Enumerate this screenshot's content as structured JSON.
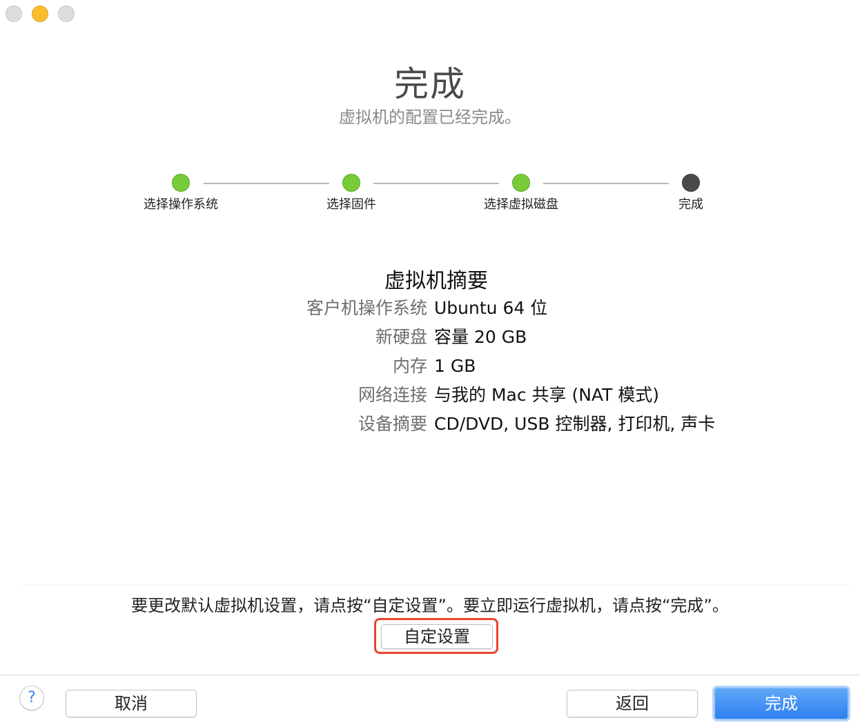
{
  "window": {
    "controls": {
      "close": "close-button",
      "minimize": "minimize-button",
      "zoom": "zoom-button"
    }
  },
  "header": {
    "title": "完成",
    "subtitle": "虚拟机的配置已经完成。"
  },
  "steps": [
    {
      "label": "选择操作系统",
      "state": "done"
    },
    {
      "label": "选择固件",
      "state": "done"
    },
    {
      "label": "选择虚拟磁盘",
      "state": "done"
    },
    {
      "label": "完成",
      "state": "current"
    }
  ],
  "summary": {
    "title": "虚拟机摘要",
    "rows": [
      {
        "key": "客户机操作系统",
        "value": "Ubuntu 64 位"
      },
      {
        "key": "新硬盘",
        "value": "容量 20 GB"
      },
      {
        "key": "内存",
        "value": "1 GB"
      },
      {
        "key": "网络连接",
        "value": "与我的 Mac 共享 (NAT 模式)"
      },
      {
        "key": "设备摘要",
        "value": "CD/DVD, USB 控制器, 打印机, 声卡"
      }
    ]
  },
  "hint": "要更改默认虚拟机设置，请点按“自定设置”。要立即运行虚拟机，请点按“完成”。",
  "custom_button": "自定设置",
  "footer": {
    "help": "?",
    "cancel": "取消",
    "back": "返回",
    "finish": "完成"
  },
  "colors": {
    "step_done": "#78cc38",
    "step_current": "#4a4a4a",
    "highlight": "#e8452a",
    "primary": "#2f7ff0"
  }
}
